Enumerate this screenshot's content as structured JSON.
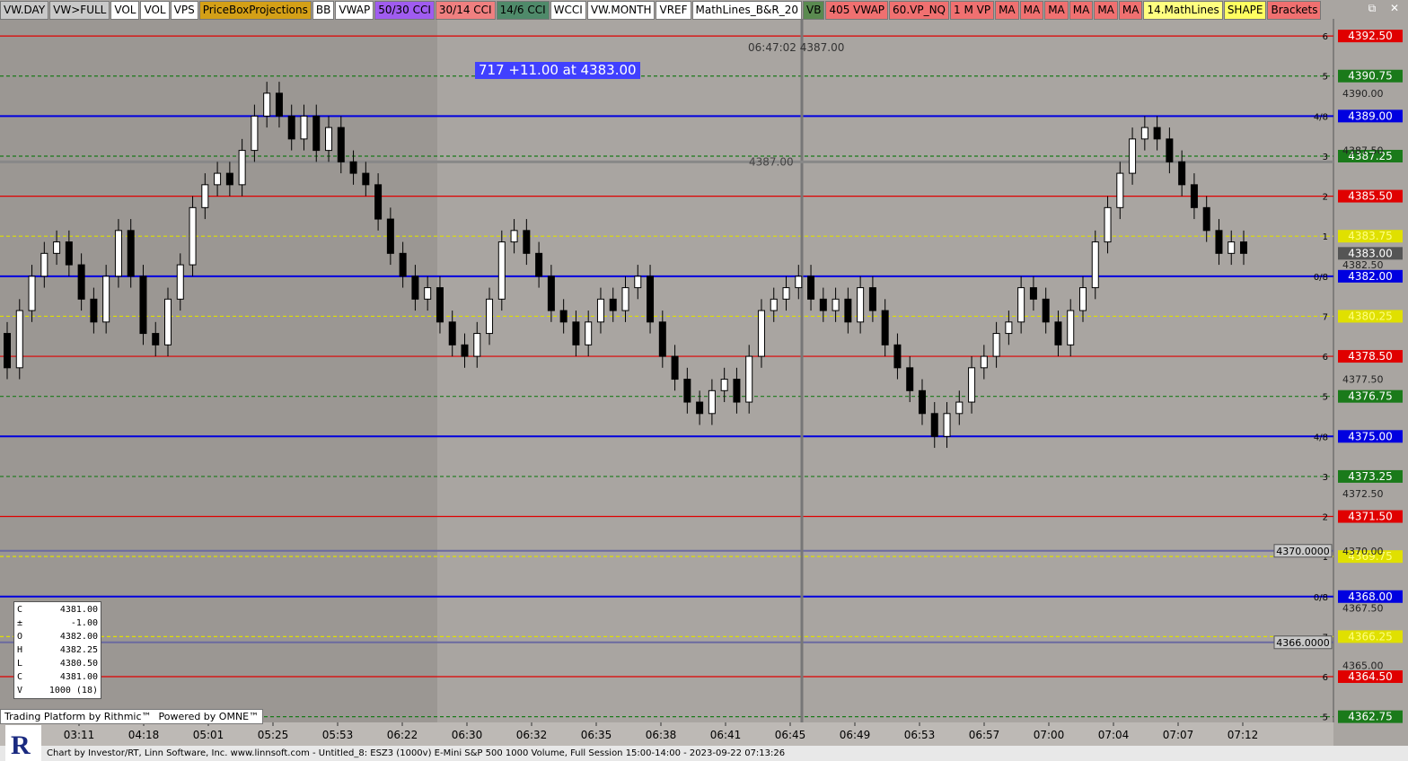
{
  "toolbar": [
    {
      "label": "VW.DAY",
      "bg": "#c9c9c9"
    },
    {
      "label": "VW>FULL",
      "bg": "#c9c9c9"
    },
    {
      "label": "VOL",
      "bg": "#ffffff"
    },
    {
      "label": "VOL",
      "bg": "#ffffff"
    },
    {
      "label": "VPS",
      "bg": "#ffffff"
    },
    {
      "label": "PriceBoxProjections",
      "bg": "#d4a017"
    },
    {
      "label": "BB",
      "bg": "#ffffff"
    },
    {
      "label": "VWAP",
      "bg": "#ffffff"
    },
    {
      "label": "50/30 CCI",
      "bg": "#a05cf0"
    },
    {
      "label": "30/14 CCI",
      "bg": "#f08080"
    },
    {
      "label": "14/6 CCI",
      "bg": "#4f8a6a"
    },
    {
      "label": "WCCI",
      "bg": "#ffffff"
    },
    {
      "label": "VW.MONTH",
      "bg": "#ffffff"
    },
    {
      "label": "VREF",
      "bg": "#ffffff"
    },
    {
      "label": "MathLines_B&R_20",
      "bg": "#ffffff"
    },
    {
      "label": "VB",
      "bg": "#5a8a50"
    },
    {
      "label": "405 VWAP",
      "bg": "#f07070"
    },
    {
      "label": "60.VP_NQ",
      "bg": "#f07070"
    },
    {
      "label": "1 M VP",
      "bg": "#f07070"
    },
    {
      "label": "MA",
      "bg": "#f07070"
    },
    {
      "label": "MA",
      "bg": "#f07070"
    },
    {
      "label": "MA",
      "bg": "#f07070"
    },
    {
      "label": "MA",
      "bg": "#f07070"
    },
    {
      "label": "MA",
      "bg": "#f07070"
    },
    {
      "label": "MA",
      "bg": "#f07070"
    },
    {
      "label": "14.MathLines",
      "bg": "#ffff80"
    },
    {
      "label": "SHAPE",
      "bg": "#ffff60"
    },
    {
      "label": "Brackets",
      "bg": "#f07070"
    }
  ],
  "window_controls": "⧉ ✕",
  "trade_label": "717  +11.00 at 4383.00",
  "timestamp_label": "06:47:02  4387.00",
  "mid_label": "4387.00",
  "ohlc_panel": [
    {
      "k": "C",
      "v": "4381.00"
    },
    {
      "k": "±",
      "v": "-1.00"
    },
    {
      "k": "O",
      "v": "4382.00"
    },
    {
      "k": "H",
      "v": "4382.25"
    },
    {
      "k": "L",
      "v": "4380.50"
    },
    {
      "k": "C",
      "v": "4381.00"
    },
    {
      "k": "V",
      "v": "1000  (18)"
    }
  ],
  "powered_bar": {
    "left": "Trading Platform by Rithmic™",
    "right": "Powered by OMNE™"
  },
  "footer_text": "Chart by Investor/RT, Linn Software, Inc. www.linnsoft.com - Untitled_8: ESZ3 (1000v) E-Mini S&P 500 1000 Volume, Full Session 15:00-14:00 - 2023-09-22 07:13:26",
  "chart_data": {
    "type": "candlestick",
    "ylim": [
      4362.5,
      4393.25
    ],
    "y_ticks": [
      "4390.00",
      "4387.50",
      "4382.50",
      "4377.50",
      "4372.50",
      "4370.00",
      "4367.50",
      "4365.00"
    ],
    "x_ticks": [
      "03:11",
      "04:18",
      "05:01",
      "05:25",
      "05:53",
      "06:22",
      "06:30",
      "06:32",
      "06:35",
      "06:38",
      "06:41",
      "06:45",
      "06:49",
      "06:53",
      "06:57",
      "07:00",
      "07:04",
      "07:07",
      "07:12"
    ],
    "current_price": "4383.00",
    "math_lines": [
      {
        "price": 4392.5,
        "label": "4392.50",
        "tag": "6",
        "color": "#e00000",
        "style": "solid"
      },
      {
        "price": 4390.75,
        "label": "4390.75",
        "tag": "5",
        "color": "#1a7a1a",
        "style": "dashed"
      },
      {
        "price": 4389.0,
        "label": "4389.00",
        "tag": "4/8",
        "color": "#0000e0",
        "style": "solid"
      },
      {
        "price": 4387.25,
        "label": "4387.25",
        "tag": "3",
        "color": "#1a7a1a",
        "style": "dashed"
      },
      {
        "price": 4385.5,
        "label": "4385.50",
        "tag": "2",
        "color": "#e00000",
        "style": "solid"
      },
      {
        "price": 4383.75,
        "label": "4383.75",
        "tag": "1",
        "color": "#e0e000",
        "style": "dashed"
      },
      {
        "price": 4382.0,
        "label": "4382.00",
        "tag": "0/8",
        "color": "#0000e0",
        "style": "solid"
      },
      {
        "price": 4380.25,
        "label": "4380.25",
        "tag": "7",
        "color": "#e0e000",
        "style": "dashed"
      },
      {
        "price": 4378.5,
        "label": "4378.50",
        "tag": "6",
        "color": "#e00000",
        "style": "solid"
      },
      {
        "price": 4376.75,
        "label": "4376.75",
        "tag": "5",
        "color": "#1a7a1a",
        "style": "dashed"
      },
      {
        "price": 4375.0,
        "label": "4375.00",
        "tag": "4/8",
        "color": "#0000e0",
        "style": "solid"
      },
      {
        "price": 4373.25,
        "label": "4373.25",
        "tag": "3",
        "color": "#1a7a1a",
        "style": "dashed"
      },
      {
        "price": 4371.5,
        "label": "4371.50",
        "tag": "2",
        "color": "#e00000",
        "style": "solid"
      },
      {
        "price": 4369.75,
        "label": "4369.75",
        "tag": "1",
        "color": "#e0e000",
        "style": "dashed"
      },
      {
        "price": 4368.0,
        "label": "4368.00",
        "tag": "0/8",
        "color": "#0000e0",
        "style": "solid"
      },
      {
        "price": 4366.25,
        "label": "4366.25",
        "tag": "7",
        "color": "#e0e000",
        "style": "dashed"
      },
      {
        "price": 4364.5,
        "label": "4364.50",
        "tag": "6",
        "color": "#e00000",
        "style": "solid"
      },
      {
        "price": 4362.75,
        "label": "4362.75",
        "tag": "5",
        "color": "#1a7a1a",
        "style": "dashed"
      }
    ],
    "gray_levels": [
      {
        "price": 4370.0,
        "label": "4370.0000"
      },
      {
        "price": 4366.0,
        "label": "4366.0000"
      }
    ],
    "closes": [
      4378.0,
      4380.5,
      4382.0,
      4383.0,
      4383.5,
      4382.5,
      4381.0,
      4380.0,
      4382.0,
      4384.0,
      4382.0,
      4379.5,
      4379.0,
      4381.0,
      4382.5,
      4385.0,
      4386.0,
      4386.5,
      4386.0,
      4387.5,
      4389.0,
      4390.0,
      4389.0,
      4388.0,
      4389.0,
      4387.5,
      4388.5,
      4387.0,
      4386.5,
      4386.0,
      4384.5,
      4383.0,
      4382.0,
      4381.0,
      4381.5,
      4380.0,
      4379.0,
      4378.5,
      4379.5,
      4381.0,
      4383.5,
      4384.0,
      4383.0,
      4382.0,
      4380.5,
      4380.0,
      4379.0,
      4380.0,
      4381.0,
      4380.5,
      4381.5,
      4382.0,
      4380.0,
      4378.5,
      4377.5,
      4376.5,
      4376.0,
      4377.0,
      4377.5,
      4376.5,
      4378.5,
      4380.5,
      4381.0,
      4381.5,
      4382.0,
      4381.0,
      4380.5,
      4381.0,
      4380.0,
      4381.5,
      4380.5,
      4379.0,
      4378.0,
      4377.0,
      4376.0,
      4375.0,
      4376.0,
      4376.5,
      4378.0,
      4378.5,
      4379.5,
      4380.0,
      4381.5,
      4381.0,
      4380.0,
      4379.0,
      4380.5,
      4381.5,
      4383.5,
      4385.0,
      4386.5,
      4388.0,
      4388.5,
      4388.0,
      4387.0,
      4386.0,
      4385.0,
      4384.0,
      4383.0,
      4383.5,
      4383.0
    ],
    "opens": [
      4379.5,
      4378.0,
      4380.5,
      4382.0,
      4383.0,
      4383.5,
      4382.5,
      4381.0,
      4380.0,
      4382.0,
      4384.0,
      4382.0,
      4379.5,
      4379.0,
      4381.0,
      4382.5,
      4385.0,
      4386.0,
      4386.5,
      4386.0,
      4387.5,
      4389.0,
      4390.0,
      4389.0,
      4388.0,
      4389.0,
      4387.5,
      4388.5,
      4387.0,
      4386.5,
      4386.0,
      4384.5,
      4383.0,
      4382.0,
      4381.0,
      4381.5,
      4380.0,
      4379.0,
      4378.5,
      4379.5,
      4381.0,
      4383.5,
      4384.0,
      4383.0,
      4382.0,
      4380.5,
      4380.0,
      4379.0,
      4380.0,
      4381.0,
      4380.5,
      4381.5,
      4382.0,
      4380.0,
      4378.5,
      4377.5,
      4376.5,
      4376.0,
      4377.0,
      4377.5,
      4376.5,
      4378.5,
      4380.5,
      4381.0,
      4381.5,
      4382.0,
      4381.0,
      4380.5,
      4381.0,
      4380.0,
      4381.5,
      4380.5,
      4379.0,
      4378.0,
      4377.0,
      4376.0,
      4375.0,
      4376.0,
      4376.5,
      4378.0,
      4378.5,
      4379.5,
      4380.0,
      4381.5,
      4381.0,
      4380.0,
      4379.0,
      4380.5,
      4381.5,
      4383.5,
      4385.0,
      4386.5,
      4388.0,
      4388.5,
      4388.0,
      4387.0,
      4386.0,
      4385.0,
      4384.0,
      4383.0,
      4383.5
    ],
    "colors": {
      "up": "#ffffff",
      "down": "#000000",
      "bg": "#a9a5a1",
      "bg_left": "#9b9793"
    }
  }
}
